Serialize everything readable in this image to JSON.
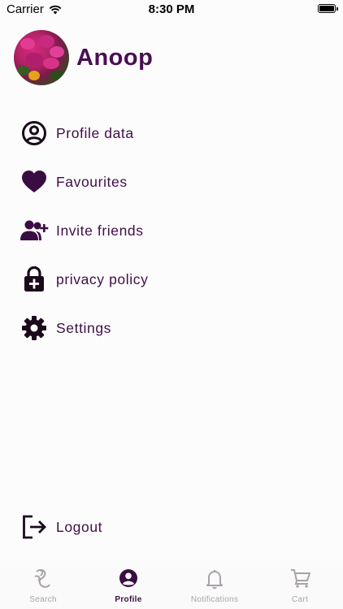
{
  "status_bar": {
    "carrier": "Carrier",
    "time": "8:30 PM"
  },
  "profile": {
    "name": "Anoop"
  },
  "menu": {
    "items": [
      {
        "label": "Profile data",
        "icon": "account-circle-icon"
      },
      {
        "label": "Favourites",
        "icon": "heart-icon"
      },
      {
        "label": "Invite friends",
        "icon": "add-person-icon"
      },
      {
        "label": "privacy policy",
        "icon": "lock-plus-icon"
      },
      {
        "label": "Settings",
        "icon": "gear-icon"
      }
    ],
    "logout": {
      "label": "Logout",
      "icon": "logout-icon"
    }
  },
  "tabs": [
    {
      "label": "Search",
      "icon": "search-feed-icon",
      "active": false
    },
    {
      "label": "Profile",
      "icon": "profile-icon",
      "active": true
    },
    {
      "label": "Notifications",
      "icon": "bell-icon",
      "active": false
    },
    {
      "label": "Cart",
      "icon": "cart-icon",
      "active": false
    }
  ],
  "colors": {
    "primary": "#4a0f52",
    "label": "#3f0d47",
    "tab_inactive": "#a8a3a8",
    "tab_active": "#3a0d42"
  }
}
